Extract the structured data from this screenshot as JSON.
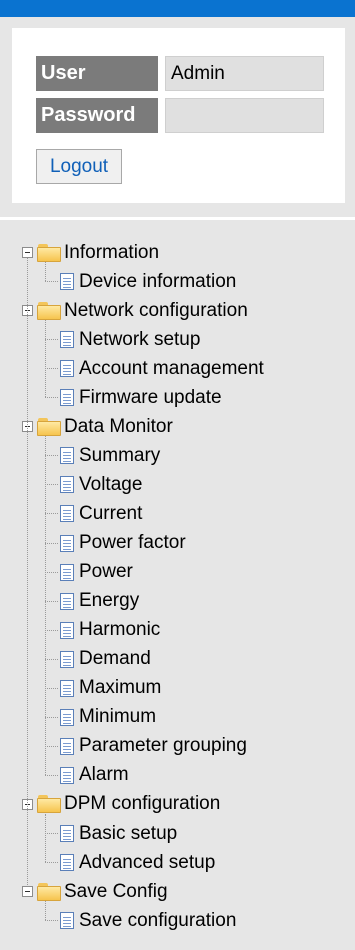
{
  "header": {
    "accent_color": "#0a73d0"
  },
  "login": {
    "user_label": "User",
    "user_value": "Admin",
    "password_label": "Password",
    "password_value": "",
    "logout_label": "Logout"
  },
  "tree": {
    "folders": [
      {
        "label": "Information",
        "icon": "folder-icon",
        "items": [
          "Device information"
        ]
      },
      {
        "label": "Network configuration",
        "icon": "folder-icon",
        "items": [
          "Network setup",
          "Account management",
          "Firmware update"
        ]
      },
      {
        "label": "Data Monitor",
        "icon": "folder-icon",
        "items": [
          "Summary",
          "Voltage",
          "Current",
          "Power factor",
          "Power",
          "Energy",
          "Harmonic",
          "Demand",
          "Maximum",
          "Minimum",
          "Parameter grouping",
          "Alarm"
        ]
      },
      {
        "label": "DPM configuration",
        "icon": "folder-icon",
        "items": [
          "Basic setup",
          "Advanced setup"
        ]
      },
      {
        "label": "Save Config",
        "icon": "folder-icon",
        "items": [
          "Save configuration"
        ]
      }
    ]
  }
}
